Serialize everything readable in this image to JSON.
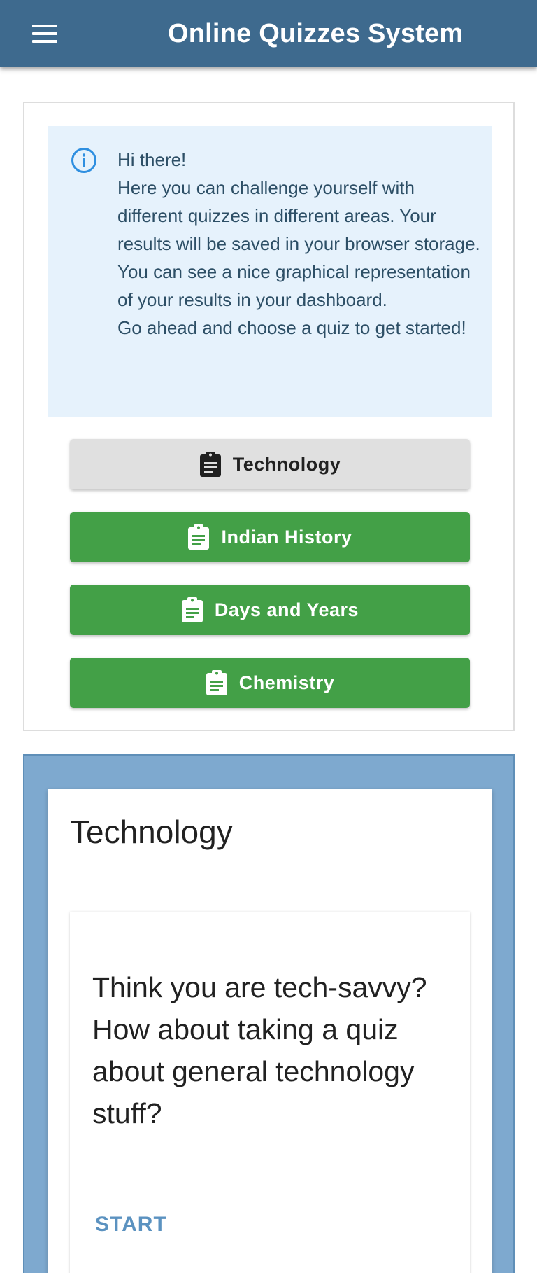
{
  "header": {
    "title": "Online Quizzes System",
    "menu_icon": "hamburger-menu-icon",
    "background": "#3e6a8e"
  },
  "intro": {
    "icon": "info-icon",
    "lines": [
      "Hi there!",
      "Here you can challenge yourself with different quizzes in different areas. Your results will be saved in your browser storage. You can see a nice graphical representation of your results in your dashboard.",
      "Go ahead and choose a quiz to get started!"
    ]
  },
  "quizzes": [
    {
      "label": "Technology",
      "icon": "clipboard-list-icon",
      "selected": true
    },
    {
      "label": "Indian History",
      "icon": "clipboard-list-icon",
      "selected": false
    },
    {
      "label": "Days and Years",
      "icon": "clipboard-list-icon",
      "selected": false
    },
    {
      "label": "Chemistry",
      "icon": "clipboard-list-icon",
      "selected": false
    }
  ],
  "selected_quiz": {
    "title": "Technology",
    "description": "Think you are tech-savvy? How about taking a quiz about general technology stuff?",
    "start_label": "START"
  },
  "colors": {
    "accent_green": "#43a047",
    "selected_gray": "#e0e0e0",
    "panel_blue": "#7ea9cf",
    "info_bg": "#e6f2fc",
    "start_text": "#5b92c0"
  }
}
